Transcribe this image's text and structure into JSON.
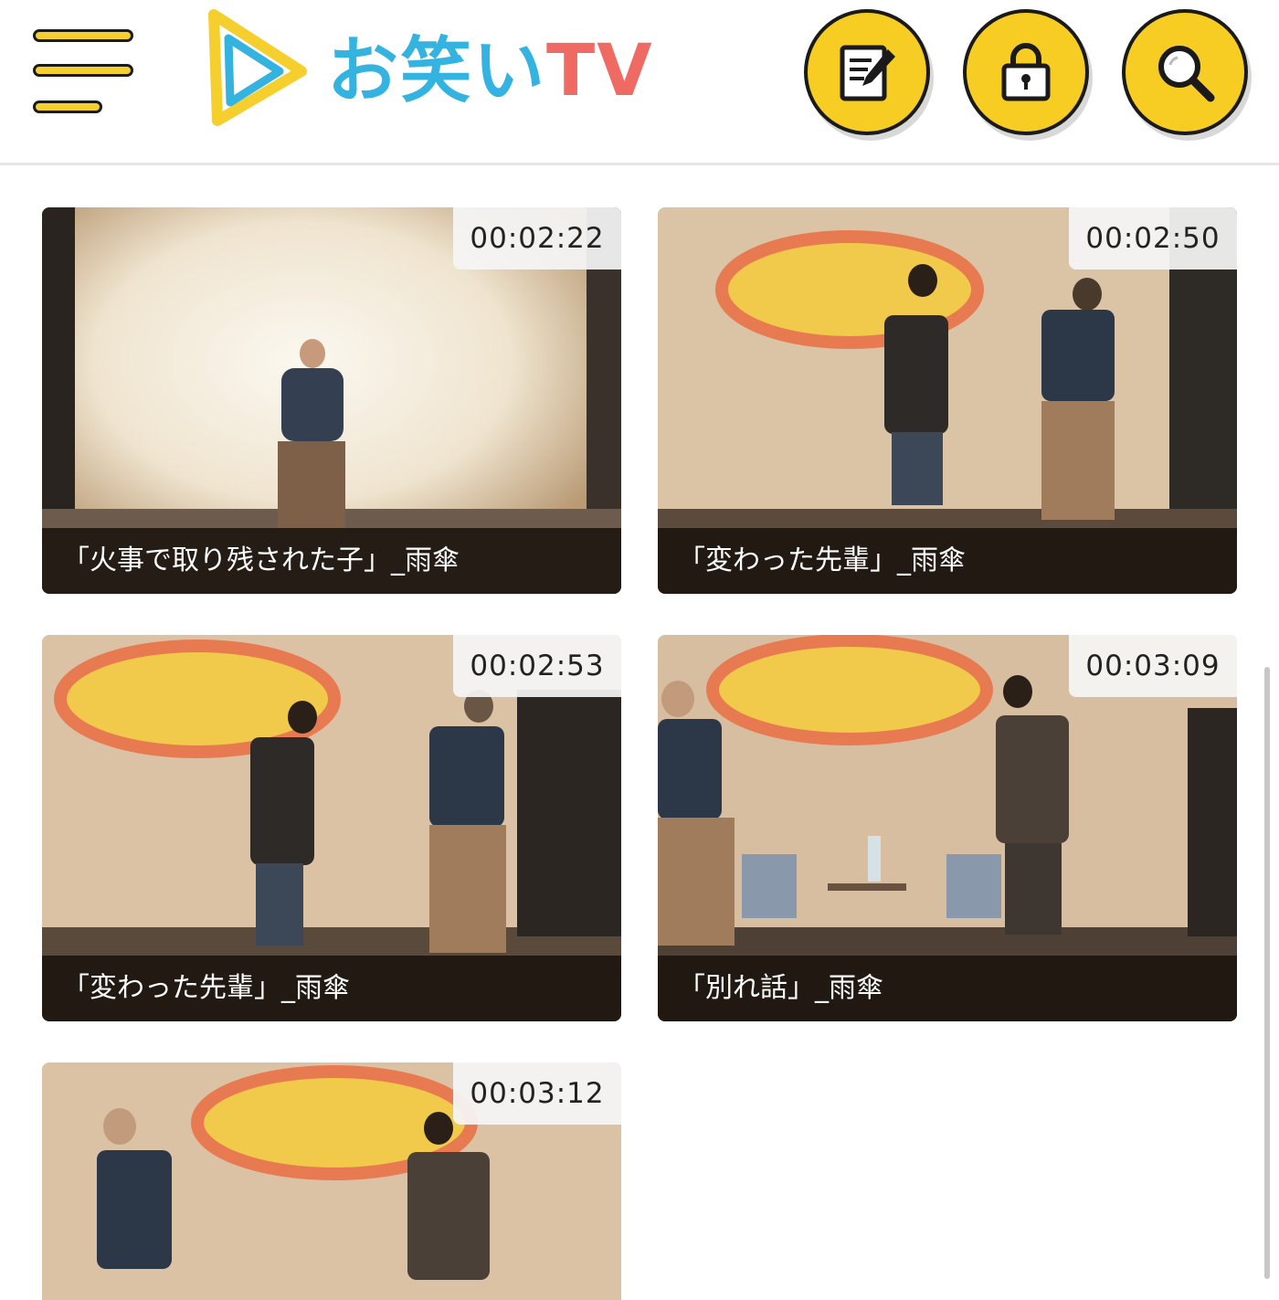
{
  "header": {
    "logo_jp": "お笑い",
    "logo_tv": "TV"
  },
  "colors": {
    "accent_yellow": "#f7cd24",
    "logo_blue": "#35b3e0",
    "logo_red": "#ef6a63"
  },
  "icons": [
    "menu-icon",
    "edit-note-icon",
    "lock-icon",
    "search-icon"
  ],
  "videos": [
    {
      "duration": "00:02:22",
      "title": "「火事で取り残された子」_雨傘"
    },
    {
      "duration": "00:02:50",
      "title": "「変わった先輩」_雨傘"
    },
    {
      "duration": "00:02:53",
      "title": "「変わった先輩」_雨傘"
    },
    {
      "duration": "00:03:09",
      "title": "「別れ話」_雨傘"
    },
    {
      "duration": "00:03:12",
      "title": ""
    }
  ]
}
